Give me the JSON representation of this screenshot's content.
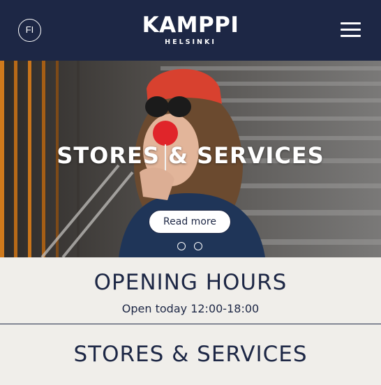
{
  "header": {
    "language_label": "FI",
    "logo_main": "KAMPPI",
    "logo_sub": "HELSINKI",
    "menu_icon": "hamburger-icon",
    "background": "#1d2745"
  },
  "hero": {
    "title": "STORES & SERVICES",
    "button_label": "Read more",
    "slide_count": 2,
    "active_slide": 1
  },
  "opening_hours": {
    "title": "OPENING HOURS",
    "text": "Open today 12:00-18:00"
  },
  "stores": {
    "title": "STORES & SERVICES"
  },
  "colors": {
    "navy": "#1d2745",
    "cream": "#f0eeea",
    "white": "#ffffff"
  }
}
